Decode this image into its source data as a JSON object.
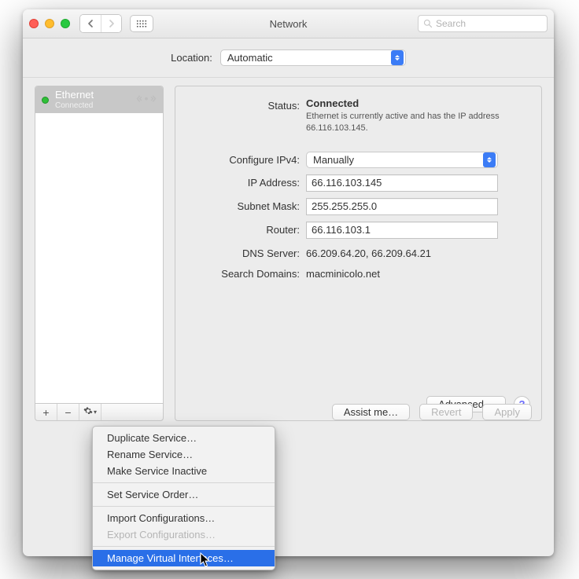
{
  "titlebar": {
    "title": "Network",
    "search_placeholder": "Search"
  },
  "location": {
    "label": "Location:",
    "value": "Automatic"
  },
  "sidebar": {
    "service": {
      "name": "Ethernet",
      "status": "Connected"
    },
    "buttons": {
      "add": "+",
      "remove": "−",
      "gear": "⚙︎"
    }
  },
  "detail": {
    "status_label": "Status:",
    "status_value": "Connected",
    "status_desc": "Ethernet is currently active and has the IP address 66.116.103.145.",
    "configure_label": "Configure IPv4:",
    "configure_value": "Manually",
    "ip_label": "IP Address:",
    "ip_value": "66.116.103.145",
    "mask_label": "Subnet Mask:",
    "mask_value": "255.255.255.0",
    "router_label": "Router:",
    "router_value": "66.116.103.1",
    "dns_label": "DNS Server:",
    "dns_value": "66.209.64.20, 66.209.64.21",
    "search_label": "Search Domains:",
    "search_value": "macminicolo.net",
    "advanced": "Advanced…"
  },
  "footer": {
    "assist": "Assist me…",
    "revert": "Revert",
    "apply": "Apply"
  },
  "menu": {
    "duplicate": "Duplicate Service…",
    "rename": "Rename Service…",
    "inactive": "Make Service Inactive",
    "order": "Set Service Order…",
    "import": "Import Configurations…",
    "export": "Export Configurations…",
    "manage": "Manage Virtual Interfaces…"
  }
}
